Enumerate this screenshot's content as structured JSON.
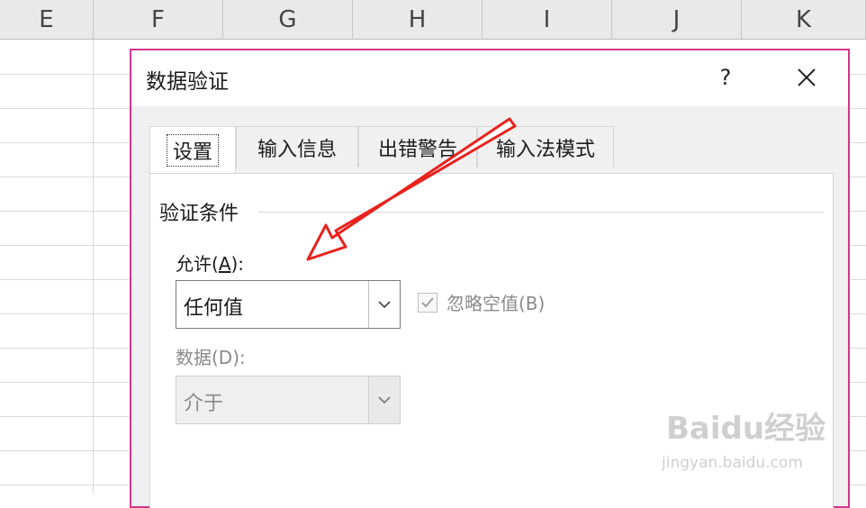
{
  "spreadsheet": {
    "columns": [
      "E",
      "F",
      "G",
      "H",
      "I",
      "J",
      "K"
    ]
  },
  "dialog": {
    "title": "数据验证",
    "help_label": "?",
    "close_label": "✕",
    "tabs": [
      "设置",
      "输入信息",
      "出错警告",
      "输入法模式"
    ],
    "active_tab": "设置",
    "group_title": "验证条件",
    "allow": {
      "label_prefix": "允许(",
      "label_key": "A",
      "label_suffix": "):",
      "value": "任何值"
    },
    "ignore_blank": {
      "label": "忽略空值(B)",
      "checked": true
    },
    "data": {
      "label": "数据(D):",
      "value": "介于"
    }
  },
  "annotation": {
    "arrow_color": "#e8221d"
  },
  "watermark": {
    "logo_text": "Baidu经验",
    "url": "jingyan.baidu.com"
  }
}
